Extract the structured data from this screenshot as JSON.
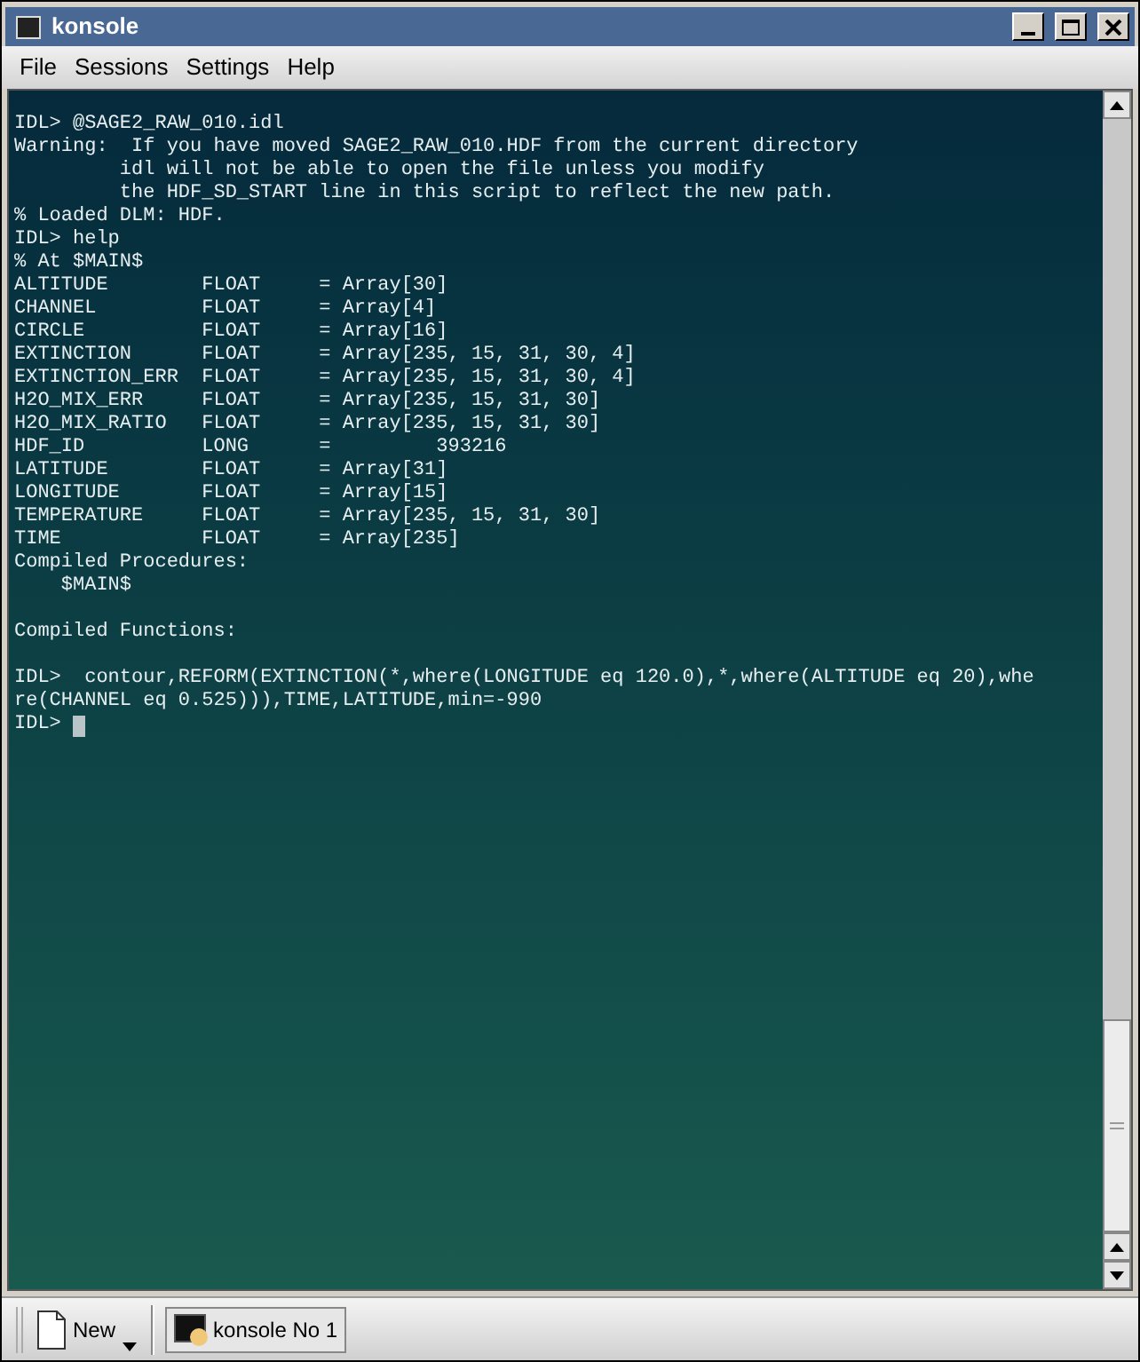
{
  "window": {
    "title": "konsole"
  },
  "menu": [
    "File",
    "Sessions",
    "Settings",
    "Help"
  ],
  "terminal": {
    "lines": [
      "IDL> @SAGE2_RAW_010.idl",
      "Warning:  If you have moved SAGE2_RAW_010.HDF from the current directory",
      "         idl will not be able to open the file unless you modify",
      "         the HDF_SD_START line in this script to reflect the new path.",
      "% Loaded DLM: HDF.",
      "IDL> help",
      "% At $MAIN$",
      "ALTITUDE        FLOAT     = Array[30]",
      "CHANNEL         FLOAT     = Array[4]",
      "CIRCLE          FLOAT     = Array[16]",
      "EXTINCTION      FLOAT     = Array[235, 15, 31, 30, 4]",
      "EXTINCTION_ERR  FLOAT     = Array[235, 15, 31, 30, 4]",
      "H2O_MIX_ERR     FLOAT     = Array[235, 15, 31, 30]",
      "H2O_MIX_RATIO   FLOAT     = Array[235, 15, 31, 30]",
      "HDF_ID          LONG      =         393216",
      "LATITUDE        FLOAT     = Array[31]",
      "LONGITUDE       FLOAT     = Array[15]",
      "TEMPERATURE     FLOAT     = Array[235, 15, 31, 30]",
      "TIME            FLOAT     = Array[235]",
      "Compiled Procedures:",
      "    $MAIN$",
      {
        "kind": "blank"
      },
      "Compiled Functions:",
      {
        "kind": "blank"
      },
      "IDL>  contour,REFORM(EXTINCTION(*,where(LONGITUDE eq 120.0),*,where(ALTITUDE eq 20),whe",
      "re(CHANNEL eq 0.525))),TIME,LATITUDE,min=-990"
    ],
    "prompt": "IDL> ",
    "cursor": true
  },
  "taskbar": [
    {
      "label": "New",
      "kind": "new"
    },
    {
      "label": "konsole No 1",
      "kind": "task",
      "selected": false
    }
  ]
}
